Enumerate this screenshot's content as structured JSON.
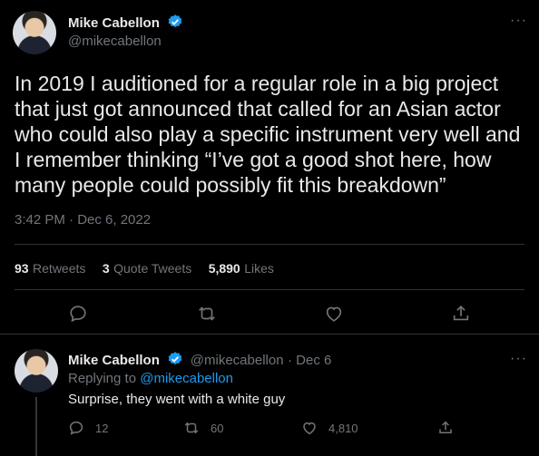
{
  "main_tweet": {
    "author_name": "Mike Cabellon",
    "author_handle": "@mikecabellon",
    "more_icon": "ellipsis-icon",
    "text": "In 2019 I auditioned for a regular role in a big project that just got announced that called for an Asian actor who could also play a specific instrument very well and I remember thinking “I’ve got a good shot here, how many people could possibly fit this breakdown”",
    "timestamp": "3:42 PM · Dec 6, 2022",
    "stats": {
      "retweets_count": "93",
      "retweets_label": "Retweets",
      "quotes_count": "3",
      "quotes_label": "Quote Tweets",
      "likes_count": "5,890",
      "likes_label": "Likes"
    },
    "actions": [
      "reply-icon",
      "retweet-icon",
      "like-icon",
      "share-icon"
    ]
  },
  "reply": {
    "author_name": "Mike Cabellon",
    "author_handle": "@mikecabellon",
    "date": "· Dec 6",
    "replying_prefix": "Replying to",
    "replying_to": "@mikecabellon",
    "text": "Surprise, they went with a white guy",
    "reply_count": "12",
    "retweet_count": "60",
    "like_count": "4,810"
  },
  "colors": {
    "background": "#000000",
    "text_primary": "#e7e9ea",
    "text_secondary": "#71767b",
    "accent": "#1d9bf0",
    "divider": "#2f3336"
  }
}
